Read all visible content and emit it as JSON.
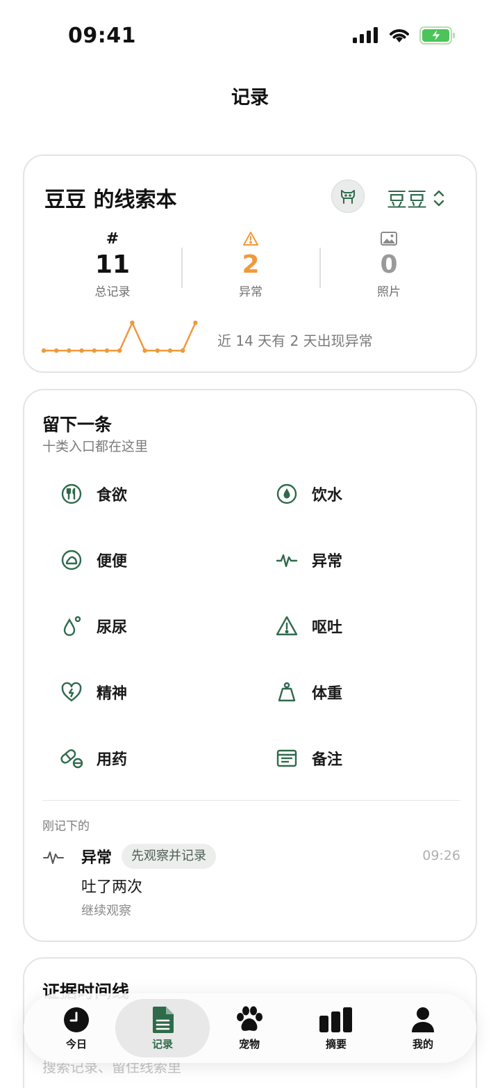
{
  "status_bar": {
    "time": "09:41"
  },
  "nav": {
    "title": "记录"
  },
  "summary": {
    "title": "豆豆 的线索本",
    "pet_name": "豆豆",
    "stats": [
      {
        "icon": "#",
        "value": "11",
        "label": "总记录",
        "color": "#111111"
      },
      {
        "icon": "warning-icon",
        "value": "2",
        "label": "异常",
        "color": "#f0993a"
      },
      {
        "icon": "photo-icon",
        "value": "0",
        "label": "照片",
        "color": "#9a9a9a"
      }
    ],
    "sparkline_values": [
      0,
      0,
      0,
      0,
      0,
      0,
      0,
      1,
      0,
      0,
      0,
      0,
      1
    ],
    "sparkline_caption": "近 14 天有 2 天出现异常",
    "accent": "#f0993a"
  },
  "quick_add": {
    "title": "留下一条",
    "subtitle": "十类入口都在这里",
    "entries": [
      {
        "label": "食欲",
        "icon": "utensils-icon"
      },
      {
        "label": "饮水",
        "icon": "water-drop-icon"
      },
      {
        "label": "便便",
        "icon": "stool-icon"
      },
      {
        "label": "异常",
        "icon": "pulse-icon"
      },
      {
        "label": "尿尿",
        "icon": "urine-drop-icon"
      },
      {
        "label": "呕吐",
        "icon": "warning-icon"
      },
      {
        "label": "精神",
        "icon": "heart-bolt-icon"
      },
      {
        "label": "体重",
        "icon": "weight-icon"
      },
      {
        "label": "用药",
        "icon": "pill-icon"
      },
      {
        "label": "备注",
        "icon": "note-icon"
      }
    ],
    "recent_title": "刚记下的",
    "recent": {
      "type": "异常",
      "badge": "先观察并记录",
      "time": "09:26",
      "text": "吐了两次",
      "sub": "继续观察"
    },
    "icon_color": "#2f6a4a"
  },
  "timeline": {
    "title": "证据时间线",
    "hint": "搜索记录、留住线索里"
  },
  "tabs": [
    {
      "label": "今日",
      "icon": "clock-icon"
    },
    {
      "label": "记录",
      "icon": "document-icon",
      "active": true
    },
    {
      "label": "宠物",
      "icon": "paw-icon"
    },
    {
      "label": "摘要",
      "icon": "bar-chart-icon"
    },
    {
      "label": "我的",
      "icon": "person-icon"
    }
  ]
}
